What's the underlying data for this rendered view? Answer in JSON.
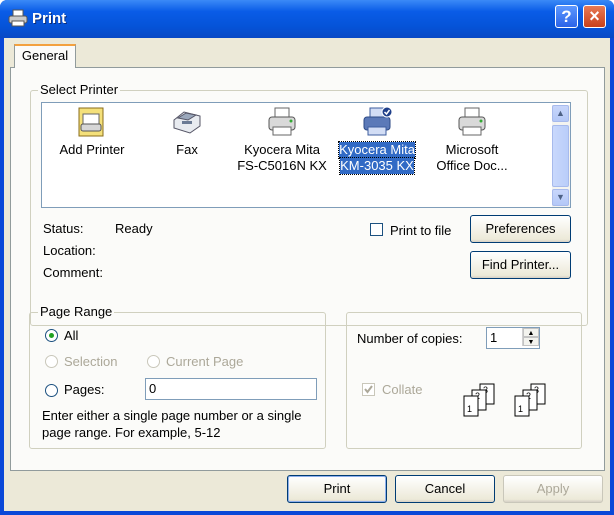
{
  "window": {
    "title": "Print",
    "help_button": "?",
    "close_button": "×"
  },
  "tabs": [
    {
      "label": "General"
    }
  ],
  "select_printer": {
    "group_label": "Select Printer",
    "printers": [
      {
        "line1": "Add Printer",
        "line2": "",
        "icon": "add-printer-icon",
        "selected": false
      },
      {
        "line1": "Fax",
        "line2": "",
        "icon": "fax-icon",
        "selected": false
      },
      {
        "line1": "Kyocera Mita",
        "line2": "FS-C5016N KX",
        "icon": "printer-icon",
        "selected": false
      },
      {
        "line1": "Kyocera Mita",
        "line2": "KM-3035 KX",
        "icon": "default-printer-icon",
        "selected": true
      },
      {
        "line1": "Microsoft",
        "line2": "Office Doc...",
        "icon": "printer-icon",
        "selected": false
      }
    ],
    "status_label": "Status:",
    "status_value": "Ready",
    "location_label": "Location:",
    "location_value": "",
    "comment_label": "Comment:",
    "comment_value": "",
    "print_to_file_label": "Print to file",
    "print_to_file_checked": false,
    "preferences_button": "Preferences",
    "find_printer_button": "Find Printer..."
  },
  "page_range": {
    "group_label": "Page Range",
    "all_label": "All",
    "selection_label": "Selection",
    "current_page_label": "Current Page",
    "pages_label": "Pages:",
    "pages_value": "0",
    "selected_option": "all",
    "help_text_line1": "Enter either a single page number or a single",
    "help_text_line2": "page range.  For example, 5-12"
  },
  "copies": {
    "number_label": "Number of copies:",
    "number_value": "1",
    "collate_label": "Collate",
    "collate_checked": true,
    "collate_enabled": false
  },
  "buttons": {
    "print": "Print",
    "cancel": "Cancel",
    "apply": "Apply"
  }
}
